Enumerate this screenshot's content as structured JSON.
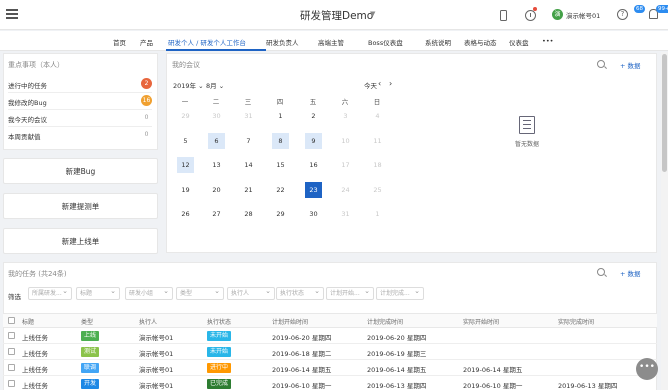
{
  "header": {
    "app_title": "研发管理Demo",
    "user_avatar": "演",
    "user_name": "演示帐号01",
    "notify_badge": "68",
    "bell_badge": "99+",
    "help_glyph": "?"
  },
  "nav": {
    "items": [
      "首页",
      "产品",
      "研发个人 / 研发个人工作台",
      "研发负责人",
      "高端主管",
      "Boss仪表盘",
      "系统说明",
      "表格与动态",
      "仪表盘",
      "•••"
    ]
  },
  "todo": {
    "title": "重点事项（本人）",
    "rows": [
      {
        "label": "进行中的任务",
        "count": "2",
        "color": "#e8663d"
      },
      {
        "label": "我修改的Bug",
        "count": "16",
        "color": "#f0a030"
      },
      {
        "label": "我今天的会议",
        "count": "0",
        "color": ""
      },
      {
        "label": "本周贡献值",
        "count": "0",
        "color": ""
      }
    ]
  },
  "buttons": {
    "new_bug": "新建Bug",
    "new_proposal": "新建提测单",
    "new_release": "新建上线单"
  },
  "meetings": {
    "title": "我的会议",
    "year": "2019年",
    "month": "8月",
    "today": "今天",
    "add": "+ 数据",
    "no_data": "暂无数据",
    "weekdays": [
      "一",
      "二",
      "三",
      "四",
      "五",
      "六",
      "日"
    ],
    "weeks": [
      [
        {
          "d": "29",
          "t": "dim"
        },
        {
          "d": "30",
          "t": "dim"
        },
        {
          "d": "31",
          "t": "dim"
        },
        {
          "d": "1",
          "t": ""
        },
        {
          "d": "2",
          "t": ""
        },
        {
          "d": "3",
          "t": "dim"
        },
        {
          "d": "4",
          "t": "dim"
        }
      ],
      [
        {
          "d": "5",
          "t": ""
        },
        {
          "d": "6",
          "t": "event"
        },
        {
          "d": "7",
          "t": ""
        },
        {
          "d": "8",
          "t": "event"
        },
        {
          "d": "9",
          "t": "event"
        },
        {
          "d": "10",
          "t": "dim"
        },
        {
          "d": "11",
          "t": "dim"
        }
      ],
      [
        {
          "d": "12",
          "t": "event"
        },
        {
          "d": "13",
          "t": ""
        },
        {
          "d": "14",
          "t": ""
        },
        {
          "d": "15",
          "t": ""
        },
        {
          "d": "16",
          "t": ""
        },
        {
          "d": "17",
          "t": "dim"
        },
        {
          "d": "18",
          "t": "dim"
        }
      ],
      [
        {
          "d": "19",
          "t": ""
        },
        {
          "d": "20",
          "t": ""
        },
        {
          "d": "21",
          "t": ""
        },
        {
          "d": "22",
          "t": ""
        },
        {
          "d": "23",
          "t": "today"
        },
        {
          "d": "24",
          "t": "dim"
        },
        {
          "d": "25",
          "t": "dim"
        }
      ],
      [
        {
          "d": "26",
          "t": ""
        },
        {
          "d": "27",
          "t": ""
        },
        {
          "d": "28",
          "t": ""
        },
        {
          "d": "29",
          "t": ""
        },
        {
          "d": "30",
          "t": ""
        },
        {
          "d": "31",
          "t": "dim"
        },
        {
          "d": "1",
          "t": "dim"
        }
      ]
    ]
  },
  "tasks": {
    "title": "我的任务 (共24条)",
    "add": "+ 数据",
    "filter_label": "筛选",
    "filters": [
      "所属研发...",
      "标题",
      "研发小组",
      "类型",
      "执行人",
      "执行状态",
      "计划开始...",
      "计划完成..."
    ],
    "columns": [
      "标题",
      "类型",
      "执行人",
      "执行状态",
      "计划开始时间",
      "计划完成时间",
      "实际开始时间",
      "实际完成时间"
    ],
    "rows": [
      {
        "title": "上线任务",
        "type": "上线",
        "type_color": "#4caf50",
        "owner": "演示帐号01",
        "status": "未开始",
        "status_color": "#29b6e8",
        "plan_start": "2019-06-20 星期四",
        "plan_end": "2019-06-20 星期四",
        "act_start": "",
        "act_end": ""
      },
      {
        "title": "上线任务",
        "type": "测试",
        "type_color": "#8bc34a",
        "owner": "演示帐号01",
        "status": "未开始",
        "status_color": "#29b6e8",
        "plan_start": "2019-06-18 星期二",
        "plan_end": "2019-06-19 星期三",
        "act_start": "",
        "act_end": ""
      },
      {
        "title": "上线任务",
        "type": "联调",
        "type_color": "#42a5f5",
        "owner": "演示帐号01",
        "status": "进行中",
        "status_color": "#ff9800",
        "plan_start": "2019-06-14 星期五",
        "plan_end": "2019-06-14 星期五",
        "act_start": "2019-06-14 星期五",
        "act_end": ""
      },
      {
        "title": "上线任务",
        "type": "开发",
        "type_color": "#1e88e5",
        "owner": "演示帐号01",
        "status": "已完成",
        "status_color": "#2e7d32",
        "plan_start": "2019-06-10 星期一",
        "plan_end": "2019-06-13 星期四",
        "act_start": "2019-06-10 星期一",
        "act_end": "2019-06-13 星期四"
      }
    ]
  },
  "float_button": "•••"
}
